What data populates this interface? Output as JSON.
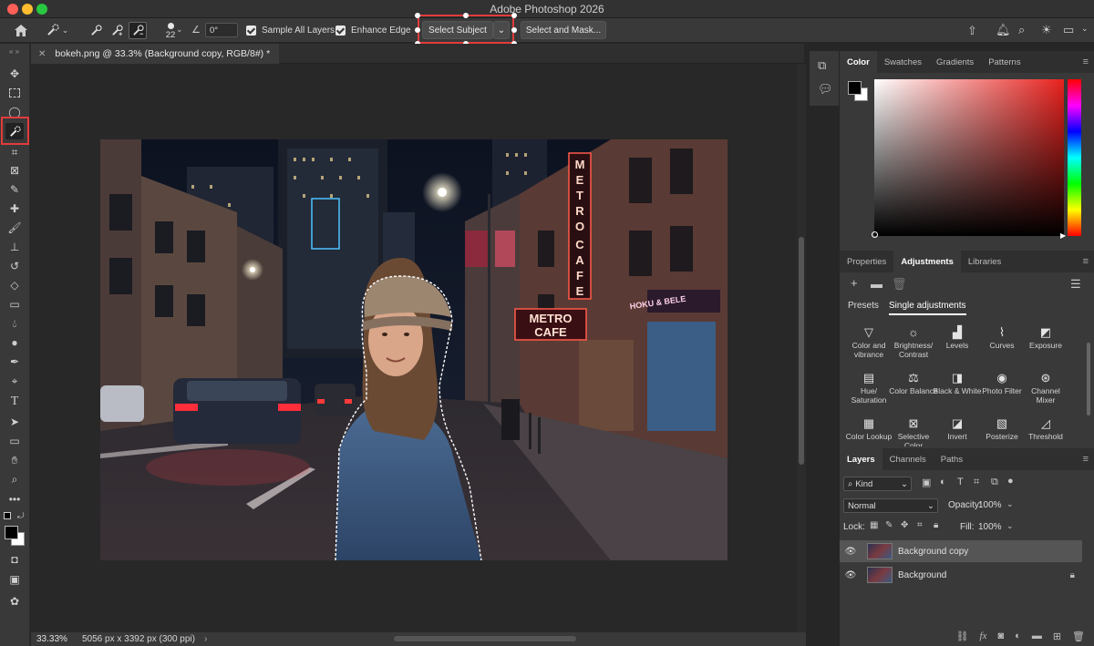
{
  "window": {
    "title": "Adobe Photoshop 2026",
    "traffic_lights": [
      "#fe5f57",
      "#febc2e",
      "#28c840"
    ]
  },
  "options_bar": {
    "brush_size": "22",
    "angle": "0°",
    "sample_all_layers": {
      "label": "Sample All Layers",
      "checked": true
    },
    "enhance_edge": {
      "label": "Enhance Edge",
      "checked": true
    },
    "select_subject_label": "Select Subject",
    "select_and_mask_label": "Select and Mask...",
    "highlight_color": "#e23b3b"
  },
  "document": {
    "tab_title": "bokeh.png @ 33.3% (Background copy, RGB/8#) *",
    "zoom": "33.33%",
    "info": "5056 px x 3392 px (300 ppi)"
  },
  "photo_signs": {
    "vertical_sign": [
      "M",
      "E",
      "T",
      "R",
      "O",
      "C",
      "A",
      "F",
      "E"
    ],
    "horizontal_sign": [
      "METRO",
      "CAFE"
    ],
    "store_sign": "HOKU & BELE"
  },
  "color_panel": {
    "tabs": [
      "Color",
      "Swatches",
      "Gradients",
      "Patterns"
    ],
    "active_tab": "Color",
    "foreground": "#000000",
    "background": "#ffffff",
    "hue": "#e8221e"
  },
  "adjustments_panel": {
    "tabs": [
      "Properties",
      "Adjustments",
      "Libraries"
    ],
    "active_tab": "Adjustments",
    "subtabs": [
      "Presets",
      "Single adjustments"
    ],
    "active_subtab": "Single adjustments",
    "items": [
      {
        "label": "Color and vibrance",
        "icon": "triangle-icon"
      },
      {
        "label": "Brightness/ Contrast",
        "icon": "sun-icon"
      },
      {
        "label": "Levels",
        "icon": "levels-icon"
      },
      {
        "label": "Curves",
        "icon": "curves-icon"
      },
      {
        "label": "Exposure",
        "icon": "exposure-icon"
      },
      {
        "label": "Hue/ Saturation",
        "icon": "hue-icon"
      },
      {
        "label": "Color Balance",
        "icon": "balance-icon"
      },
      {
        "label": "Black & White",
        "icon": "bw-icon"
      },
      {
        "label": "Photo Filter",
        "icon": "camera-icon"
      },
      {
        "label": "Channel Mixer",
        "icon": "mixer-icon"
      },
      {
        "label": "Color Lookup",
        "icon": "grid-icon"
      },
      {
        "label": "Selective Color",
        "icon": "selective-icon"
      },
      {
        "label": "Invert",
        "icon": "invert-icon"
      },
      {
        "label": "Posterize",
        "icon": "posterize-icon"
      },
      {
        "label": "Threshold",
        "icon": "threshold-icon"
      }
    ]
  },
  "layers_panel": {
    "tabs": [
      "Layers",
      "Channels",
      "Paths"
    ],
    "active_tab": "Layers",
    "filter_kind": "Kind",
    "blend_mode": "Normal",
    "opacity_label": "Opacity:",
    "opacity": "100%",
    "lock_label": "Lock:",
    "fill_label": "Fill:",
    "fill": "100%",
    "layers": [
      {
        "name": "Background copy",
        "selected": true,
        "locked": false
      },
      {
        "name": "Background",
        "selected": false,
        "locked": true
      }
    ]
  }
}
